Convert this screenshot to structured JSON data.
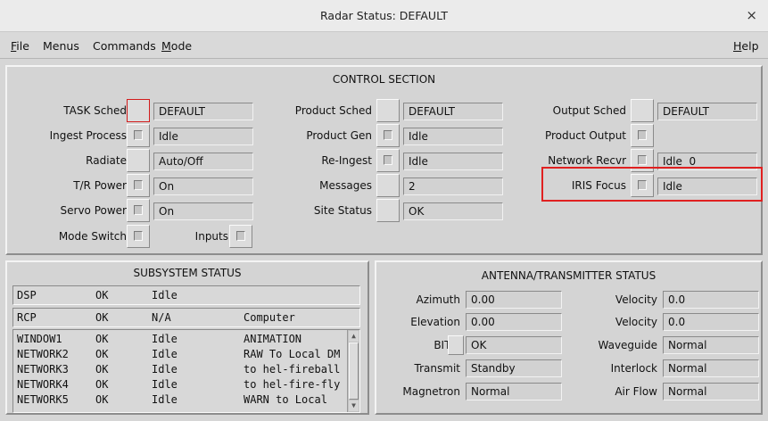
{
  "window": {
    "title": "Radar Status: DEFAULT",
    "close": "×"
  },
  "menu": {
    "file": "File",
    "menus": "Menus",
    "commands": "Commands",
    "mode": "Mode",
    "help": "Help"
  },
  "control": {
    "title": "CONTROL SECTION",
    "task_sched": {
      "label": "TASK Sched",
      "value": "DEFAULT"
    },
    "ingest_process": {
      "label": "Ingest Process",
      "value": "Idle"
    },
    "radiate": {
      "label": "Radiate",
      "value": "Auto/Off"
    },
    "tr_power": {
      "label": "T/R Power",
      "value": "On"
    },
    "servo_power": {
      "label": "Servo Power",
      "value": "On"
    },
    "mode_switch": {
      "label": "Mode Switch"
    },
    "inputs": {
      "label": "Inputs"
    },
    "product_sched": {
      "label": "Product Sched",
      "value": "DEFAULT"
    },
    "product_gen": {
      "label": "Product Gen",
      "value": "Idle"
    },
    "re_ingest": {
      "label": "Re-Ingest",
      "value": "Idle"
    },
    "messages": {
      "label": "Messages",
      "value": "2"
    },
    "site_status": {
      "label": "Site Status",
      "value": "OK"
    },
    "output_sched": {
      "label": "Output Sched",
      "value": "DEFAULT"
    },
    "product_output": {
      "label": "Product Output"
    },
    "network_recvr": {
      "label": "Network Recvr",
      "value": "Idle  0"
    },
    "iris_focus": {
      "label": "IRIS Focus",
      "value": "Idle"
    }
  },
  "subsystem": {
    "title": "SUBSYSTEM STATUS",
    "rows": [
      {
        "name": "DSP",
        "status": "OK",
        "state": "Idle",
        "info": ""
      },
      {
        "name": "RCP",
        "status": "OK",
        "state": "N/A",
        "info": "Computer"
      }
    ],
    "list": [
      {
        "name": "WINDOW1",
        "status": "OK",
        "state": "Idle",
        "info": "ANIMATION"
      },
      {
        "name": "NETWORK2",
        "status": "OK",
        "state": "Idle",
        "info": "RAW To Local DM"
      },
      {
        "name": "NETWORK3",
        "status": "OK",
        "state": "Idle",
        "info": "to hel-fireball"
      },
      {
        "name": "NETWORK4",
        "status": "OK",
        "state": "Idle",
        "info": "to hel-fire-fly"
      },
      {
        "name": "NETWORK5",
        "status": "OK",
        "state": "Idle",
        "info": "WARN to Local"
      }
    ]
  },
  "antenna": {
    "title": "ANTENNA/TRANSMITTER STATUS",
    "azimuth": {
      "label": "Azimuth",
      "value": "0.00"
    },
    "elevation": {
      "label": "Elevation",
      "value": "0.00"
    },
    "bite": {
      "label": "BITE",
      "value": "OK"
    },
    "transmit": {
      "label": "Transmit",
      "value": "Standby"
    },
    "magnetron": {
      "label": "Magnetron",
      "value": "Normal"
    },
    "velocity1": {
      "label": "Velocity",
      "value": "0.0"
    },
    "velocity2": {
      "label": "Velocity",
      "value": "0.0"
    },
    "waveguide": {
      "label": "Waveguide",
      "value": "Normal"
    },
    "interlock": {
      "label": "Interlock",
      "value": "Normal"
    },
    "airflow": {
      "label": "Air Flow",
      "value": "Normal"
    }
  }
}
